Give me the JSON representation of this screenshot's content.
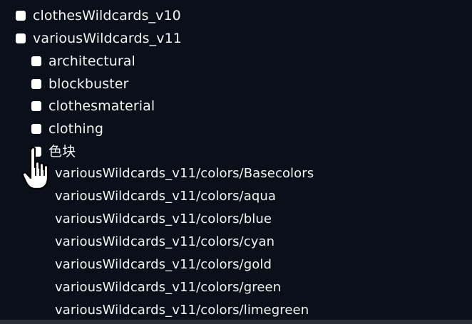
{
  "tree": {
    "top_items": [
      {
        "label": "clothesWildcards_v10"
      },
      {
        "label": "variousWildcards_v11"
      }
    ],
    "sub_items": [
      {
        "label": "architectural"
      },
      {
        "label": "blockbuster"
      },
      {
        "label": "clothesmaterial"
      },
      {
        "label": "clothing"
      },
      {
        "label": "色块"
      }
    ],
    "leaves": [
      {
        "label": "variousWildcards_v11/colors/Basecolors"
      },
      {
        "label": "variousWildcards_v11/colors/aqua"
      },
      {
        "label": "variousWildcards_v11/colors/blue"
      },
      {
        "label": "variousWildcards_v11/colors/cyan"
      },
      {
        "label": "variousWildcards_v11/colors/gold"
      },
      {
        "label": "variousWildcards_v11/colors/green"
      },
      {
        "label": "variousWildcards_v11/colors/limegreen"
      }
    ]
  },
  "cursor": {
    "icon": "hand-pointer-icon"
  },
  "colors": {
    "background": "#0b0f19",
    "text": "#f4f4f5",
    "node_box": "#ffffff"
  }
}
